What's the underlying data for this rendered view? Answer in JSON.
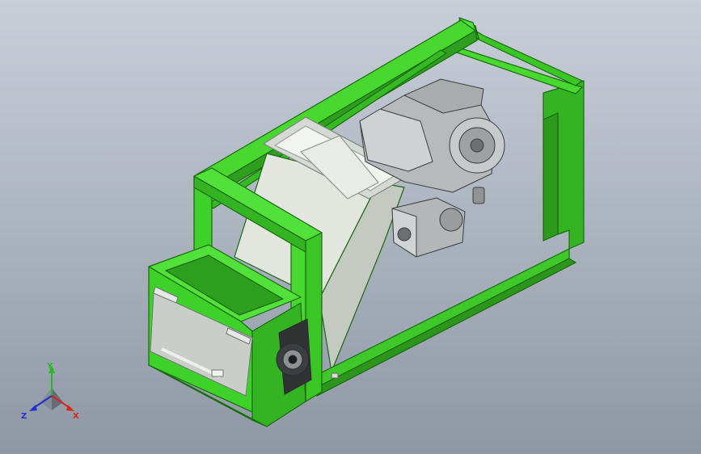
{
  "scene": {
    "background_top": "#c9cfd9",
    "background_bottom": "#8e97a4",
    "frame_color": "#3ed12a",
    "frame_edge": "#1a6a10",
    "hopper_color": "#dfe3dc",
    "engine_color": "#b9bcbd"
  },
  "triad": {
    "x_label": "X",
    "y_label": "Y",
    "z_label": "Z",
    "x_color": "#d8261d",
    "y_color": "#2fb52a",
    "z_color": "#2430c8"
  }
}
